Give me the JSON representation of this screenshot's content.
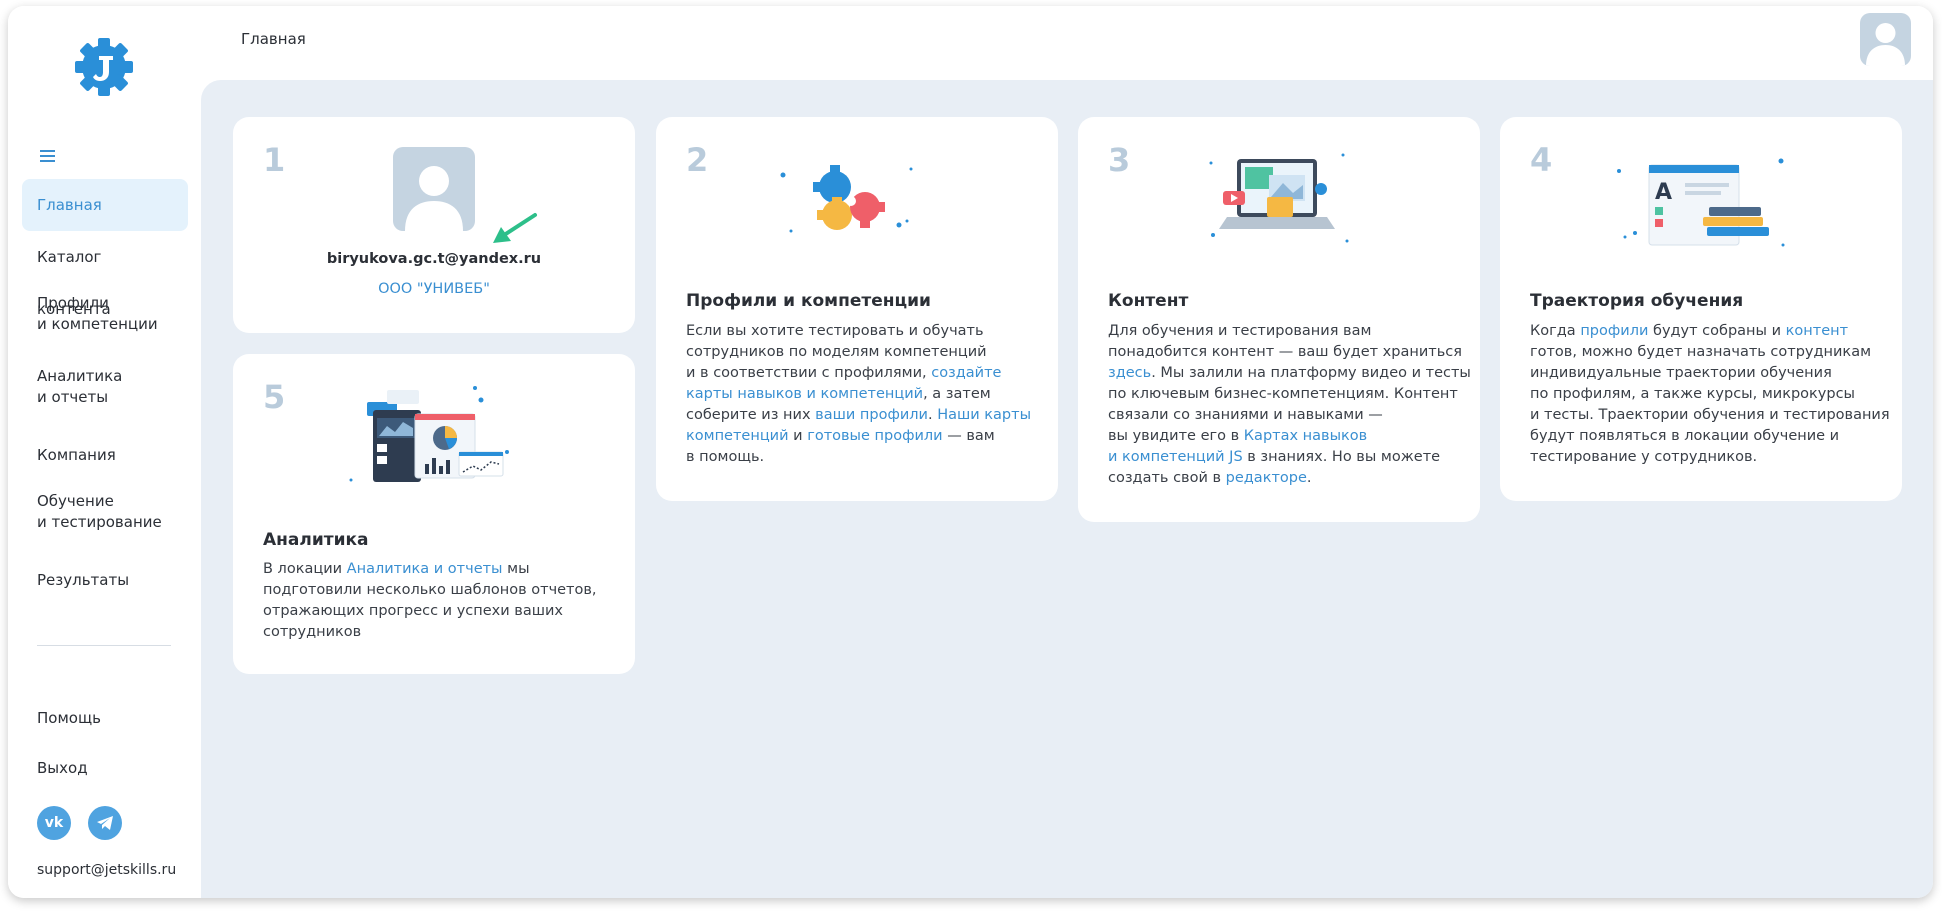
{
  "sidebar": {
    "items": [
      {
        "label": "Главная",
        "label2": ""
      },
      {
        "label": "Каталог контента",
        "label2": ""
      },
      {
        "label": "Профили",
        "label2": "и компетенции"
      },
      {
        "label": "Аналитика",
        "label2": "и отчеты"
      },
      {
        "label": "Компания",
        "label2": ""
      },
      {
        "label": "Обучение",
        "label2": "и тестирование"
      },
      {
        "label": "Результаты",
        "label2": ""
      }
    ],
    "bottom": [
      {
        "label": "Помощь"
      },
      {
        "label": "Выход"
      }
    ],
    "vk": "vk",
    "support_email": "support@jetskills.ru"
  },
  "header": {
    "breadcrumb": "Главная"
  },
  "cards": {
    "profile": {
      "num": "1",
      "email": "biryukova.gc.t@yandex.ru",
      "company": "ООО \"УНИВЕБ\""
    },
    "competencies": {
      "num": "2",
      "title": "Профили и компетенции",
      "t1": "Если вы хотите тестировать и обучать",
      "t2": "сотрудников по моделям компетенций",
      "t3a": "и в соответствии с профилями, ",
      "t3link": "создайте",
      "t4link": "карты навыков и компетенций",
      "t4b": ", а затем",
      "t5a": "соберите из них ",
      "t5link": "ваши профили",
      "t5b": ". ",
      "t5link2": "Наши карты",
      "t6link": "компетенций",
      "t6b": " и ",
      "t6link2": "готовые профили",
      "t6c": " — вам",
      "t7": "в помощь."
    },
    "content": {
      "num": "3",
      "title": "Контент",
      "t1": "Для обучения и тестирования вам",
      "t2": "понадобится контент — ваш будет храниться",
      "t3link": "здесь",
      "t3b": ". Мы залили на платформу видео и тесты",
      "t4": "по ключевым бизнес-компетенциям. Контент",
      "t5": "связали со знаниями и навыками —",
      "t6a": "вы увидите его в ",
      "t6link": "Картах навыков",
      "t7link": "и компетенций JS",
      "t7b": " в знаниях. Но вы можете",
      "t8a": "создать свой в ",
      "t8link": "редакторе",
      "t8b": "."
    },
    "trajectory": {
      "num": "4",
      "title": "Траектория обучения",
      "t1a": "Когда ",
      "t1link": "профили",
      "t1b": " будут собраны и ",
      "t1link2": "контент",
      "t2": "готов, можно будет назначать сотрудникам",
      "t3": "индивидуальные траектории обучения",
      "t4": "по профилям, а также курсы, микрокурсы",
      "t5": "и тесты. Траектории обучения и тестирования",
      "t6": "будут появляться в локации обучение и",
      "t7": "тестирование у сотрудников."
    },
    "analytics": {
      "num": "5",
      "title": "Аналитика",
      "t1a": "В локации ",
      "t1link": "Аналитика и отчеты",
      "t1b": " мы",
      "t2": "подготовили несколько шаблонов отчетов,",
      "t3": "отражающих прогресс и успехи ваших",
      "t4": "сотрудников"
    }
  },
  "colors": {
    "accent": "#3a8fd1",
    "background": "#e8eef5",
    "number": "#b9cbdb",
    "arrow": "#2dbf8a"
  }
}
